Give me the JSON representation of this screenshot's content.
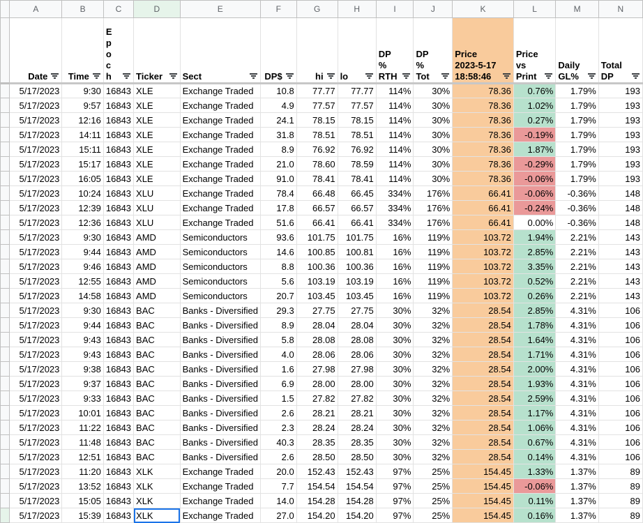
{
  "columns": [
    "A",
    "B",
    "C",
    "D",
    "E",
    "F",
    "G",
    "H",
    "I",
    "J",
    "K",
    "L",
    "M",
    "N"
  ],
  "headers": {
    "date": "Date",
    "time": "Time",
    "epoch": "E\np\no\nc\nh",
    "ticker": "Ticker",
    "sect": "Sect",
    "dp": "DP$",
    "hi": "hi",
    "lo": "lo",
    "dp_rth": "DP\n%\nRTH",
    "dp_tot": "DP\n%\nTot",
    "price": "Price\n2023-5-17\n18:58:46",
    "price_vs_print": "Price\nvs\nPrint",
    "daily_gl": "Daily\nGL%",
    "total_dp": "Total\nDP"
  },
  "status_colors": {
    "positive": "#b7e1cd",
    "negative": "#ea9999",
    "price_column": "#f9cb9c"
  },
  "rows": [
    [
      "5/17/2023",
      "9:30",
      "16843",
      "XLE",
      "Exchange Traded",
      "10.8",
      "77.77",
      "77.77",
      "114%",
      "30%",
      "78.36",
      "0.76%",
      "1.79%",
      "193"
    ],
    [
      "5/17/2023",
      "9:57",
      "16843",
      "XLE",
      "Exchange Traded",
      "4.9",
      "77.57",
      "77.57",
      "114%",
      "30%",
      "78.36",
      "1.02%",
      "1.79%",
      "193"
    ],
    [
      "5/17/2023",
      "12:16",
      "16843",
      "XLE",
      "Exchange Traded",
      "24.1",
      "78.15",
      "78.15",
      "114%",
      "30%",
      "78.36",
      "0.27%",
      "1.79%",
      "193"
    ],
    [
      "5/17/2023",
      "14:11",
      "16843",
      "XLE",
      "Exchange Traded",
      "31.8",
      "78.51",
      "78.51",
      "114%",
      "30%",
      "78.36",
      "-0.19%",
      "1.79%",
      "193"
    ],
    [
      "5/17/2023",
      "15:11",
      "16843",
      "XLE",
      "Exchange Traded",
      "8.9",
      "76.92",
      "76.92",
      "114%",
      "30%",
      "78.36",
      "1.87%",
      "1.79%",
      "193"
    ],
    [
      "5/17/2023",
      "15:17",
      "16843",
      "XLE",
      "Exchange Traded",
      "21.0",
      "78.60",
      "78.59",
      "114%",
      "30%",
      "78.36",
      "-0.29%",
      "1.79%",
      "193"
    ],
    [
      "5/17/2023",
      "16:05",
      "16843",
      "XLE",
      "Exchange Traded",
      "91.0",
      "78.41",
      "78.41",
      "114%",
      "30%",
      "78.36",
      "-0.06%",
      "1.79%",
      "193"
    ],
    [
      "5/17/2023",
      "10:24",
      "16843",
      "XLU",
      "Exchange Traded",
      "78.4",
      "66.48",
      "66.45",
      "334%",
      "176%",
      "66.41",
      "-0.06%",
      "-0.36%",
      "148"
    ],
    [
      "5/17/2023",
      "12:39",
      "16843",
      "XLU",
      "Exchange Traded",
      "17.8",
      "66.57",
      "66.57",
      "334%",
      "176%",
      "66.41",
      "-0.24%",
      "-0.36%",
      "148"
    ],
    [
      "5/17/2023",
      "12:36",
      "16843",
      "XLU",
      "Exchange Traded",
      "51.6",
      "66.41",
      "66.41",
      "334%",
      "176%",
      "66.41",
      "0.00%",
      "-0.36%",
      "148"
    ],
    [
      "5/17/2023",
      "9:30",
      "16843",
      "AMD",
      "Semiconductors",
      "93.6",
      "101.75",
      "101.75",
      "16%",
      "119%",
      "103.72",
      "1.94%",
      "2.21%",
      "143"
    ],
    [
      "5/17/2023",
      "9:44",
      "16843",
      "AMD",
      "Semiconductors",
      "14.6",
      "100.85",
      "100.81",
      "16%",
      "119%",
      "103.72",
      "2.85%",
      "2.21%",
      "143"
    ],
    [
      "5/17/2023",
      "9:46",
      "16843",
      "AMD",
      "Semiconductors",
      "8.8",
      "100.36",
      "100.36",
      "16%",
      "119%",
      "103.72",
      "3.35%",
      "2.21%",
      "143"
    ],
    [
      "5/17/2023",
      "12:55",
      "16843",
      "AMD",
      "Semiconductors",
      "5.6",
      "103.19",
      "103.19",
      "16%",
      "119%",
      "103.72",
      "0.52%",
      "2.21%",
      "143"
    ],
    [
      "5/17/2023",
      "14:58",
      "16843",
      "AMD",
      "Semiconductors",
      "20.7",
      "103.45",
      "103.45",
      "16%",
      "119%",
      "103.72",
      "0.26%",
      "2.21%",
      "143"
    ],
    [
      "5/17/2023",
      "9:30",
      "16843",
      "BAC",
      "Banks - Diversified",
      "29.3",
      "27.75",
      "27.75",
      "30%",
      "32%",
      "28.54",
      "2.85%",
      "4.31%",
      "106"
    ],
    [
      "5/17/2023",
      "9:44",
      "16843",
      "BAC",
      "Banks - Diversified",
      "8.9",
      "28.04",
      "28.04",
      "30%",
      "32%",
      "28.54",
      "1.78%",
      "4.31%",
      "106"
    ],
    [
      "5/17/2023",
      "9:43",
      "16843",
      "BAC",
      "Banks - Diversified",
      "5.8",
      "28.08",
      "28.08",
      "30%",
      "32%",
      "28.54",
      "1.64%",
      "4.31%",
      "106"
    ],
    [
      "5/17/2023",
      "9:43",
      "16843",
      "BAC",
      "Banks - Diversified",
      "4.0",
      "28.06",
      "28.06",
      "30%",
      "32%",
      "28.54",
      "1.71%",
      "4.31%",
      "106"
    ],
    [
      "5/17/2023",
      "9:38",
      "16843",
      "BAC",
      "Banks - Diversified",
      "1.6",
      "27.98",
      "27.98",
      "30%",
      "32%",
      "28.54",
      "2.00%",
      "4.31%",
      "106"
    ],
    [
      "5/17/2023",
      "9:37",
      "16843",
      "BAC",
      "Banks - Diversified",
      "6.9",
      "28.00",
      "28.00",
      "30%",
      "32%",
      "28.54",
      "1.93%",
      "4.31%",
      "106"
    ],
    [
      "5/17/2023",
      "9:33",
      "16843",
      "BAC",
      "Banks - Diversified",
      "1.5",
      "27.82",
      "27.82",
      "30%",
      "32%",
      "28.54",
      "2.59%",
      "4.31%",
      "106"
    ],
    [
      "5/17/2023",
      "10:01",
      "16843",
      "BAC",
      "Banks - Diversified",
      "2.6",
      "28.21",
      "28.21",
      "30%",
      "32%",
      "28.54",
      "1.17%",
      "4.31%",
      "106"
    ],
    [
      "5/17/2023",
      "11:22",
      "16843",
      "BAC",
      "Banks - Diversified",
      "2.3",
      "28.24",
      "28.24",
      "30%",
      "32%",
      "28.54",
      "1.06%",
      "4.31%",
      "106"
    ],
    [
      "5/17/2023",
      "11:48",
      "16843",
      "BAC",
      "Banks - Diversified",
      "40.3",
      "28.35",
      "28.35",
      "30%",
      "32%",
      "28.54",
      "0.67%",
      "4.31%",
      "106"
    ],
    [
      "5/17/2023",
      "12:51",
      "16843",
      "BAC",
      "Banks - Diversified",
      "2.6",
      "28.50",
      "28.50",
      "30%",
      "32%",
      "28.54",
      "0.14%",
      "4.31%",
      "106"
    ],
    [
      "5/17/2023",
      "11:20",
      "16843",
      "XLK",
      "Exchange Traded",
      "20.0",
      "152.43",
      "152.43",
      "97%",
      "25%",
      "154.45",
      "1.33%",
      "1.37%",
      "89"
    ],
    [
      "5/17/2023",
      "13:52",
      "16843",
      "XLK",
      "Exchange Traded",
      "7.7",
      "154.54",
      "154.54",
      "97%",
      "25%",
      "154.45",
      "-0.06%",
      "1.37%",
      "89"
    ],
    [
      "5/17/2023",
      "15:05",
      "16843",
      "XLK",
      "Exchange Traded",
      "14.0",
      "154.28",
      "154.28",
      "97%",
      "25%",
      "154.45",
      "0.11%",
      "1.37%",
      "89"
    ],
    [
      "5/17/2023",
      "15:39",
      "16843",
      "XLK",
      "Exchange Traded",
      "27.0",
      "154.20",
      "154.20",
      "97%",
      "25%",
      "154.45",
      "0.16%",
      "1.37%",
      "89"
    ]
  ],
  "selected_cell": {
    "row": 29,
    "col": 3
  }
}
